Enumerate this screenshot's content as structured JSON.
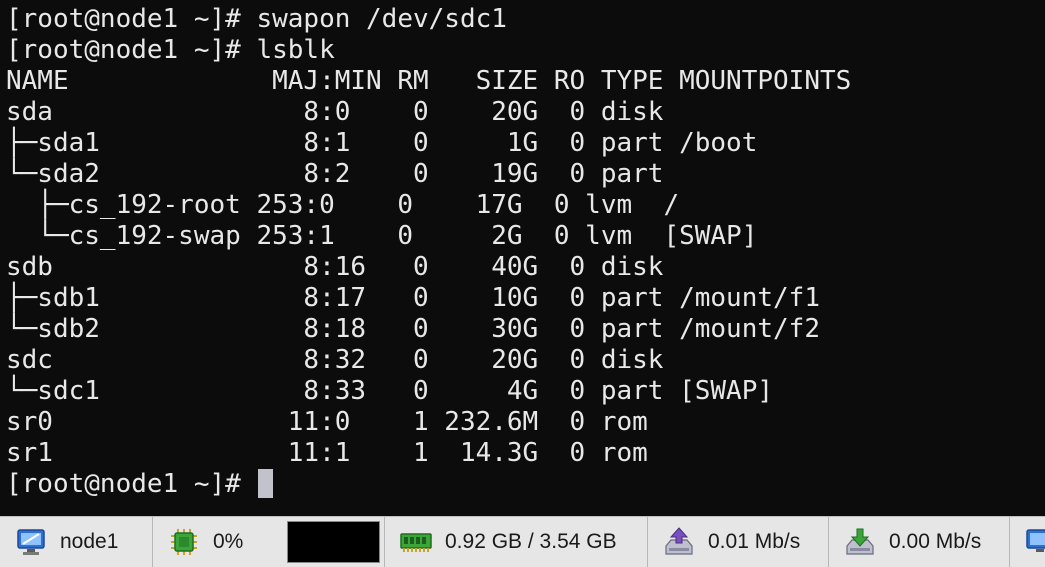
{
  "terminal": {
    "lines": [
      "[root@node1 ~]# swapon /dev/sdc1",
      "[root@node1 ~]# lsblk",
      "NAME             MAJ:MIN RM   SIZE RO TYPE MOUNTPOINTS",
      "sda                8:0    0    20G  0 disk",
      "├─sda1             8:1    0     1G  0 part /boot",
      "└─sda2             8:2    0    19G  0 part",
      "  ├─cs_192-root 253:0    0    17G  0 lvm  /",
      "  └─cs_192-swap 253:1    0     2G  0 lvm  [SWAP]",
      "sdb                8:16   0    40G  0 disk",
      "├─sdb1             8:17   0    10G  0 part /mount/f1",
      "└─sdb2             8:18   0    30G  0 part /mount/f2",
      "sdc                8:32   0    20G  0 disk",
      "└─sdc1             8:33   0     4G  0 part [SWAP]",
      "sr0               11:0    1 232.6M  0 rom",
      "sr1               11:1    1  14.3G  0 rom"
    ],
    "prompt": "[root@node1 ~]# "
  },
  "taskbar": {
    "host": {
      "label": "node1",
      "icon": "computer-icon"
    },
    "cpu": {
      "label": "0%",
      "icon": "cpu-chip-icon"
    },
    "memory": {
      "label": "0.92 GB / 3.54 GB",
      "icon": "memory-module-icon"
    },
    "upload": {
      "label": "0.01 Mb/s",
      "icon": "upload-icon"
    },
    "download": {
      "label": "0.00 Mb/s",
      "icon": "download-icon"
    },
    "colors": {
      "accent_green": "#3aa639",
      "upload_purple": "#7a4fc0",
      "cursor": "#c2c2cc"
    }
  }
}
